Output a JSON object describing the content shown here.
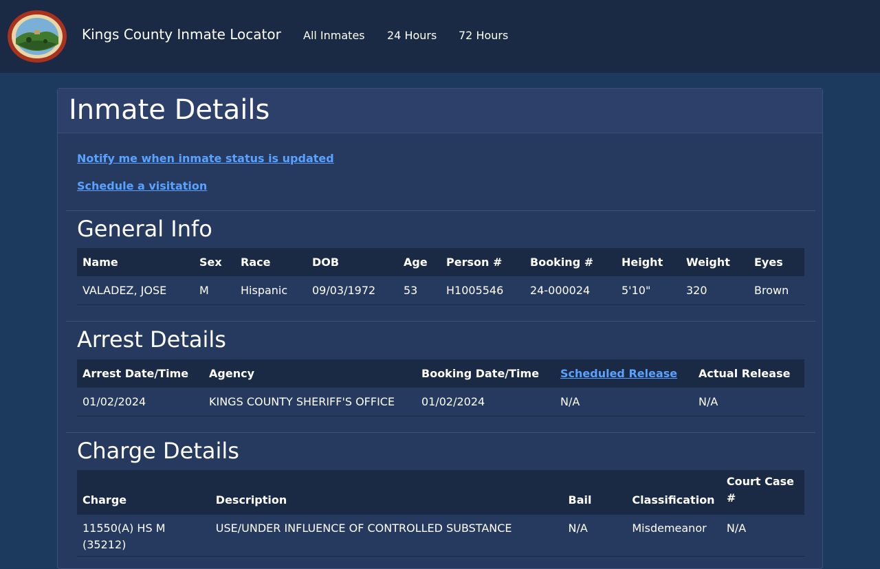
{
  "nav": {
    "brand": "Kings County Inmate Locator",
    "links": [
      "All Inmates",
      "24 Hours",
      "72 Hours"
    ],
    "logo_text": "COUNTY OF KINGS CALIFORNIA"
  },
  "page": {
    "title": "Inmate Details",
    "notify_link": "Notify me when inmate status is updated",
    "visit_link": "Schedule a visitation"
  },
  "general_info": {
    "title": "General Info",
    "headers": [
      "Name",
      "Sex",
      "Race",
      "DOB",
      "Age",
      "Person #",
      "Booking #",
      "Height",
      "Weight",
      "Eyes"
    ],
    "row": [
      "VALADEZ, JOSE",
      "M",
      "Hispanic",
      "09/03/1972",
      "53",
      "H1005546",
      "24-000024",
      "5'10\"",
      "320",
      "Brown"
    ]
  },
  "arrest_details": {
    "title": "Arrest Details",
    "headers": [
      "Arrest Date/Time",
      "Agency",
      "Booking Date/Time",
      "Scheduled Release",
      "Actual Release"
    ],
    "row": [
      "01/02/2024",
      "KINGS COUNTY SHERIFF'S OFFICE",
      "01/02/2024",
      "N/A",
      "N/A"
    ]
  },
  "charge_details": {
    "title": "Charge Details",
    "headers": [
      "Charge",
      "Description",
      "Bail",
      "Classification",
      "Court Case #"
    ],
    "row": [
      "11550(A) HS M (35212)",
      "USE/UNDER INFLUENCE OF CONTROLLED SUBSTANCE",
      "N/A",
      "Misdemeanor",
      "N/A"
    ]
  },
  "colors": {
    "background": "#1c3a5e",
    "navbar": "#1a2944",
    "card": "#263a5f",
    "link": "#5aa2ff"
  }
}
